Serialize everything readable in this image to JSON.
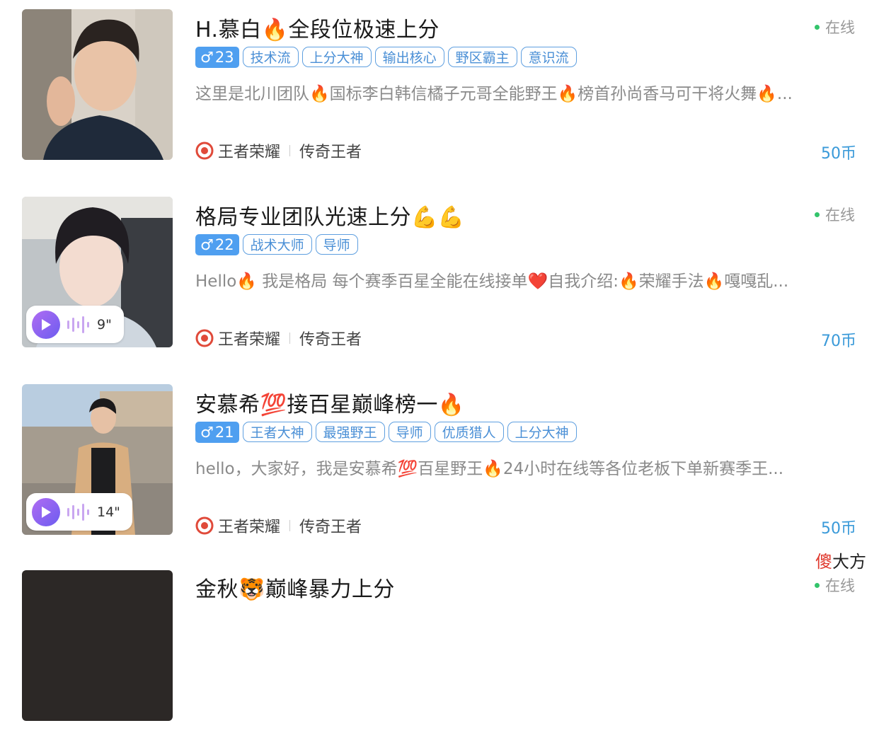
{
  "items": [
    {
      "title": "H.慕白🔥全段位极速上分",
      "status": "在线",
      "gender_symbol": "♂",
      "age": "23",
      "tags": [
        "技术流",
        "上分大神",
        "输出核心",
        "野区霸主",
        "意识流"
      ],
      "description": "这里是北川团队🔥国标李白韩信橘子元哥全能野王🔥榜首孙尚香马可干将火舞🔥...",
      "game": "王者荣耀",
      "rank": "传奇王者",
      "price": "50币",
      "voice": null
    },
    {
      "title": "格局专业团队光速上分💪💪",
      "status": "在线",
      "gender_symbol": "♂",
      "age": "22",
      "tags": [
        "战术大师",
        "导师"
      ],
      "description": "Hello🔥 我是格局 每个赛季百星全能在线接单❤️自我介绍:🔥荣耀手法🔥嘎嘎乱...",
      "game": "王者荣耀",
      "rank": "传奇王者",
      "price": "70币",
      "voice": "9\""
    },
    {
      "title": "安慕希💯接百星巅峰榜一🔥",
      "status": "",
      "gender_symbol": "♂",
      "age": "21",
      "tags": [
        "王者大神",
        "最强野王",
        "导师",
        "优质猎人",
        "上分大神"
      ],
      "description": "hello，大家好，我是安慕希💯百星野王🔥24小时在线等各位老板下单新赛季王...",
      "game": "王者荣耀",
      "rank": "传奇王者",
      "price": "50币",
      "voice": "14\""
    },
    {
      "title": "金秋🐯巅峰暴力上分",
      "status": "在线"
    }
  ],
  "watermark": {
    "a": "傻",
    "b": "大方"
  }
}
